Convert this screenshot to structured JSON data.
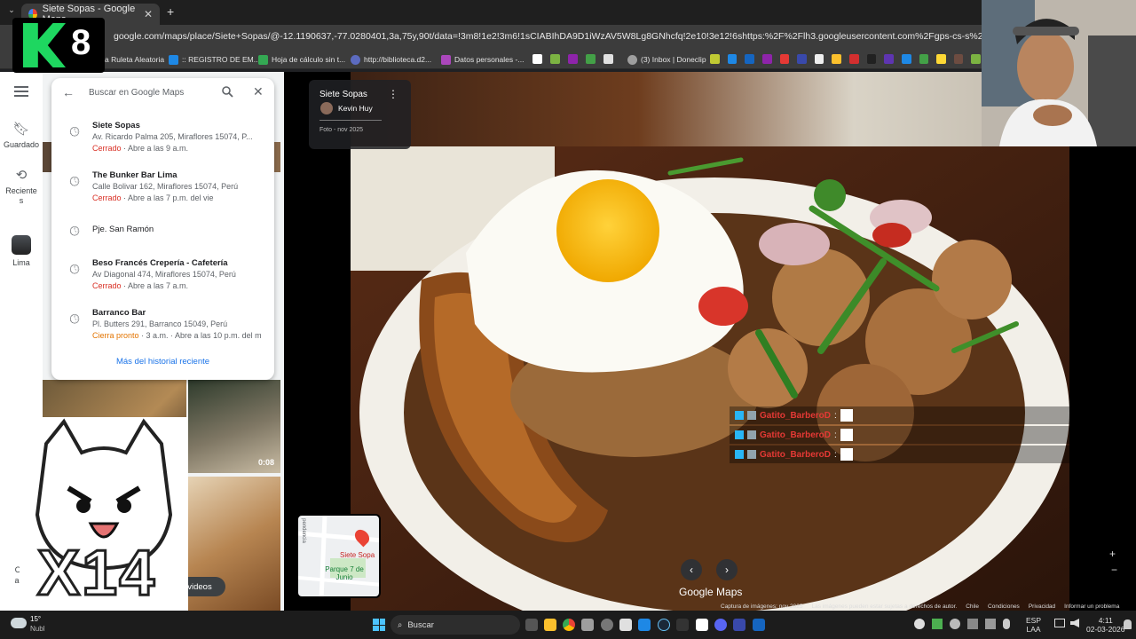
{
  "browser": {
    "tab_title": "Siete Sopas - Google Maps",
    "tab_close": "✕",
    "new_tab": "+",
    "url": "google.com/maps/place/Siete+Sopas/@-12.1190637,-77.0280401,3a,75y,90t/data=!3m8!1e2!3m6!1sCIABIhDA9D1iWzAV5W8Lg8GNhcfq!2e10!3e12!6shttps:%2F%2Flh3.googleusercontent.com%2Fgps-cs-s%2FAHVAweqWbPbArc3_-lahW_i",
    "bookmarks": [
      {
        "label": "a Ruleta Aleatoria",
        "color": "#e53935"
      },
      {
        "label": ":: REGISTRO DE EM...",
        "color": "#1e88e5"
      },
      {
        "label": "Hoja de cálculo sin t...",
        "color": "#34a853"
      },
      {
        "label": "http://biblioteca.d2...",
        "color": "#5c6bc0"
      },
      {
        "label": "Datos personales -...",
        "color": "#ab47bc"
      },
      {
        "label": "(3) Inbox | Doneclip",
        "color": "#9e9e9e"
      }
    ]
  },
  "rail": {
    "menu_icon": "menu-icon",
    "saved": "Guardado",
    "recent": "Reciente s",
    "place": "Lima",
    "get_app": "Obt app"
  },
  "search": {
    "placeholder": "Buscar en Google Maps",
    "items": [
      {
        "title": "Siete Sopas",
        "address": "Av. Ricardo Palma 205, Miraflores 15074, P...",
        "status": "Cerrado",
        "hours": " · Abre a las 9 a.m."
      },
      {
        "title": "The Bunker Bar Lima",
        "address": "Calle Bolivar 162, Miraflores 15074, Perú",
        "status": "Cerrado",
        "hours": " · Abre a las 7 p.m. del vie"
      },
      {
        "title": "Pje. San Ramón",
        "address": "",
        "status": "",
        "hours": ""
      },
      {
        "title": "Beso Francés Crepería - Cafetería",
        "address": "Av Diagonal 474, Miraflores 15074, Perú",
        "status": "Cerrado",
        "hours": " · Abre a las 7 a.m."
      },
      {
        "title": "Barranco Bar",
        "address": "Pl. Butters 291, Barranco 15049, Perú",
        "status": "Cierra pronto",
        "hours": " · 3 a.m. · Abre a las 10 p.m. del m"
      }
    ],
    "more": "Más del historial reciente"
  },
  "sidepanel": {
    "video_duration": "0:08",
    "photos_chip": "otos y videos"
  },
  "viewer": {
    "place": "Siete Sopas",
    "author": "Kevin Huy",
    "date": "Foto - nov 2025",
    "brand": "Google Maps",
    "minimap_label": "Siete Sopa",
    "minimap_park": "Parque 7 de Junio",
    "minimap_street": "pendencia",
    "footer": [
      "Captura de imágenes: nov 2025",
      "Las imágenes pueden estar sujetas a derechos de autor.",
      "Chile",
      "Condiciones",
      "Privacidad",
      "Informar un problema"
    ],
    "chat": [
      "Gatito_BarberoD",
      "Gatito_BarberoD",
      "Gatito_BarberoD"
    ]
  },
  "overlay": {
    "logo_text": "8",
    "counter": "X14"
  },
  "taskbar": {
    "weather_temp": "15°",
    "weather_desc": "Nubl",
    "search": "Buscar",
    "lang": "ESP",
    "lang2": "LAA",
    "time": "4:11",
    "date": "02-03-2026"
  }
}
